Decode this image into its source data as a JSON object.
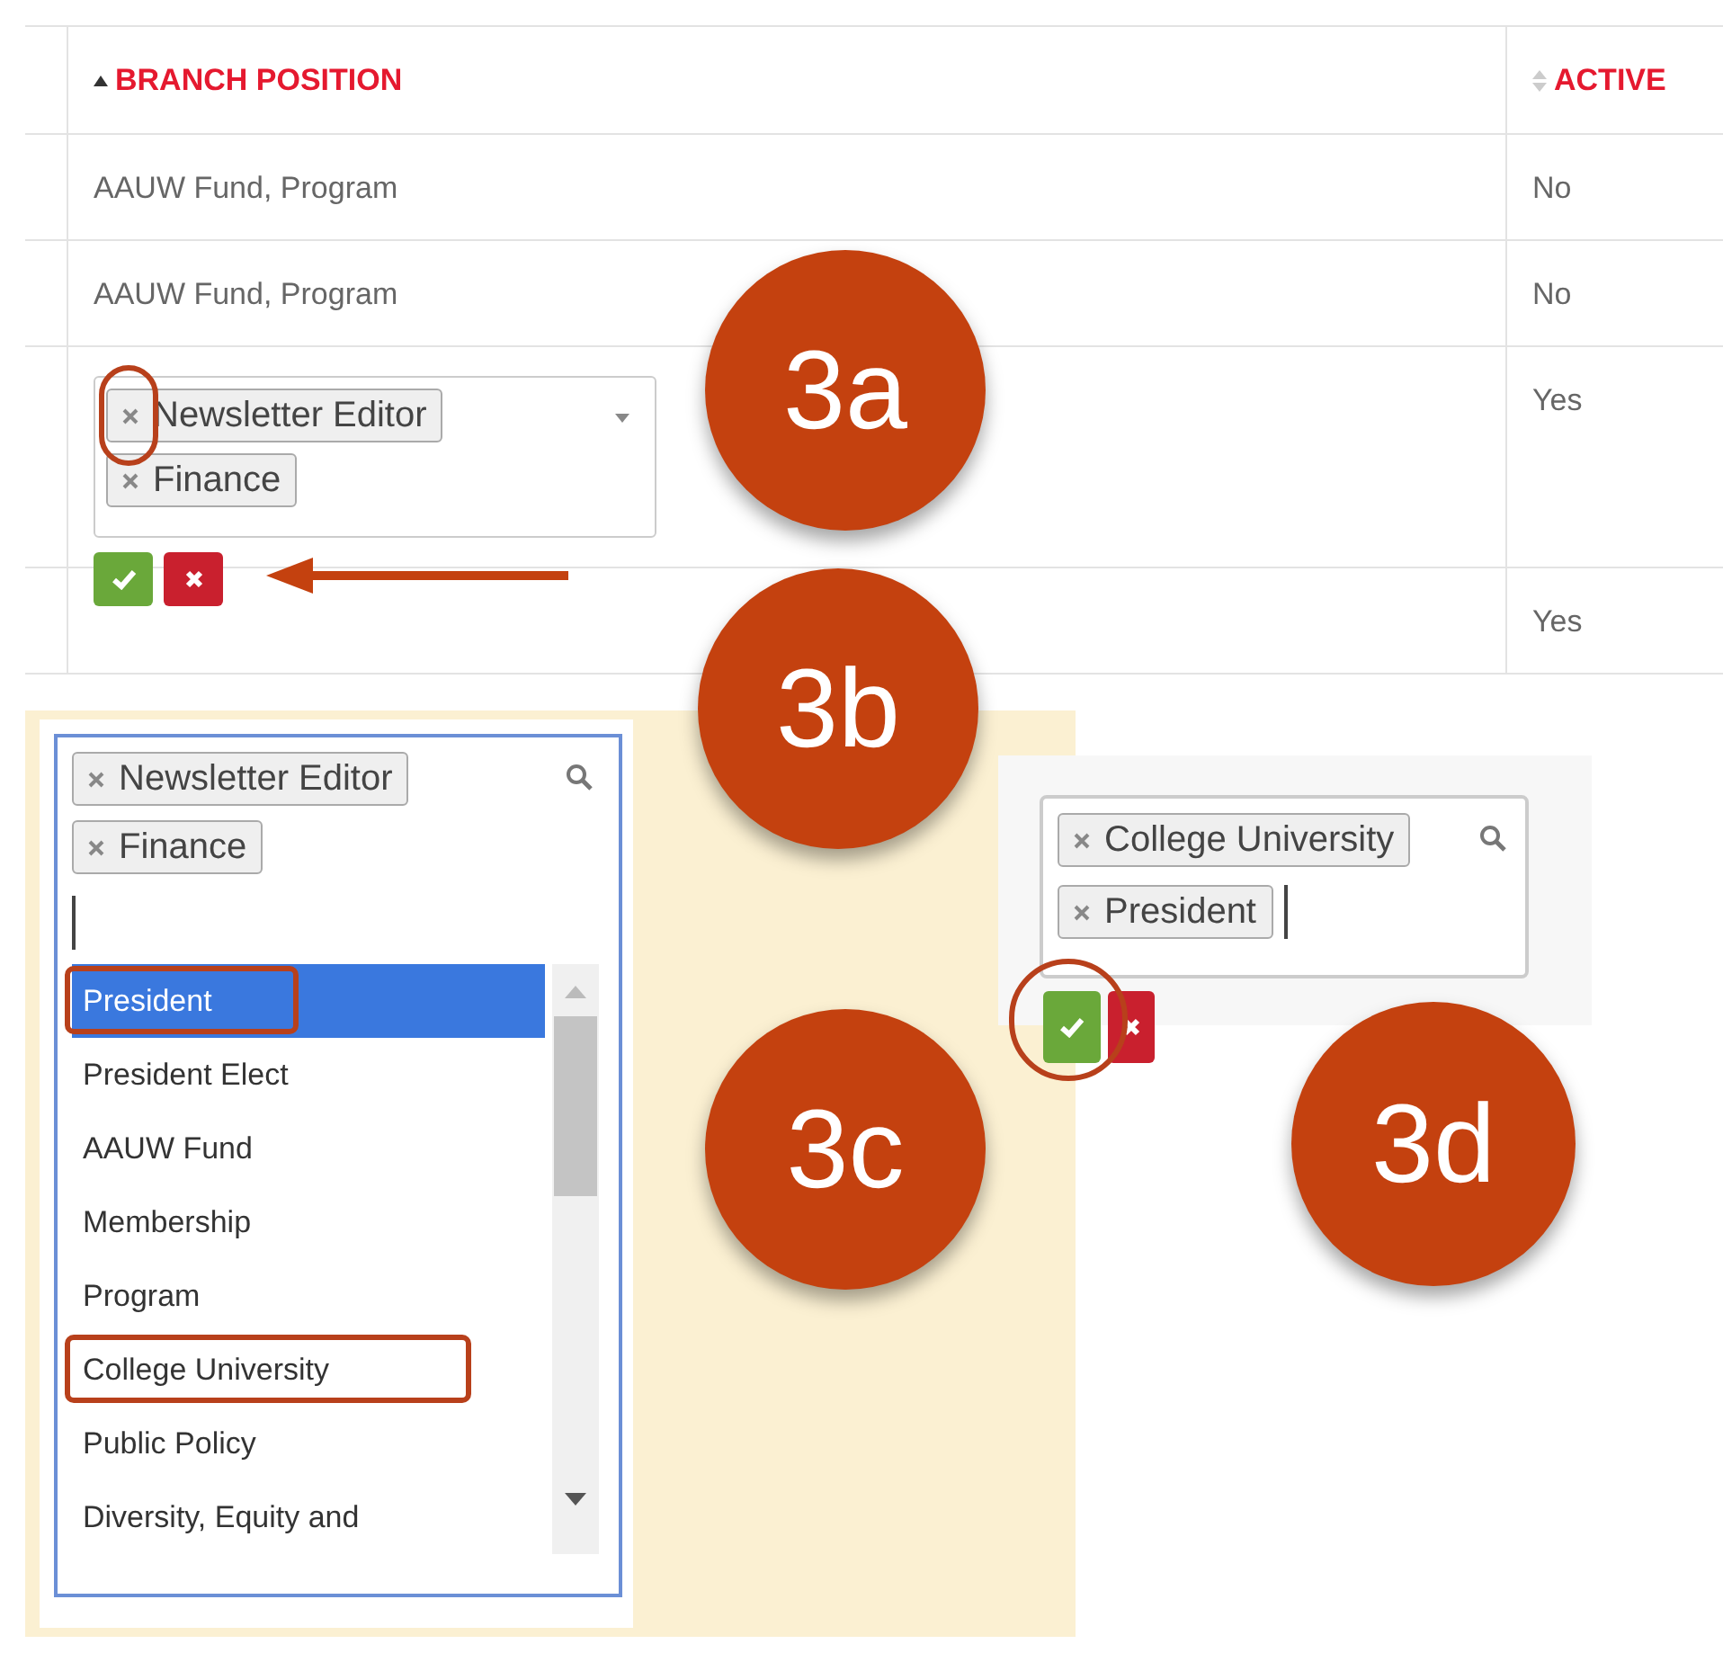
{
  "table": {
    "columns": [
      {
        "label": "BRANCH POSITION",
        "sorted": true
      },
      {
        "label": "ACTIVE",
        "sorted": false
      }
    ],
    "rows": [
      {
        "kind": "text",
        "position": "AAUW Fund, Program",
        "active": "No"
      },
      {
        "kind": "text",
        "position": "AAUW Fund, Program",
        "active": "No"
      },
      {
        "kind": "editing",
        "tags": [
          "Newsletter Editor",
          "Finance"
        ],
        "active": "Yes"
      },
      {
        "kind": "blank",
        "active": "Yes"
      }
    ]
  },
  "step_badges": [
    "3a",
    "3b",
    "3c",
    "3d"
  ],
  "dropdown_panel": {
    "tags": [
      "Newsletter Editor",
      "Finance"
    ],
    "options": [
      {
        "label": "President",
        "selected": true,
        "callout": true
      },
      {
        "label": "President Elect",
        "selected": false,
        "callout": false
      },
      {
        "label": "AAUW Fund",
        "selected": false,
        "callout": false
      },
      {
        "label": "Membership",
        "selected": false,
        "callout": false
      },
      {
        "label": "Program",
        "selected": false,
        "callout": false
      },
      {
        "label": "College University",
        "selected": false,
        "callout": true
      },
      {
        "label": "Public Policy",
        "selected": false,
        "callout": false
      },
      {
        "label": "Diversity, Equity and",
        "selected": false,
        "callout": false
      }
    ]
  },
  "result_panel": {
    "tags": [
      "College University",
      "President"
    ]
  }
}
